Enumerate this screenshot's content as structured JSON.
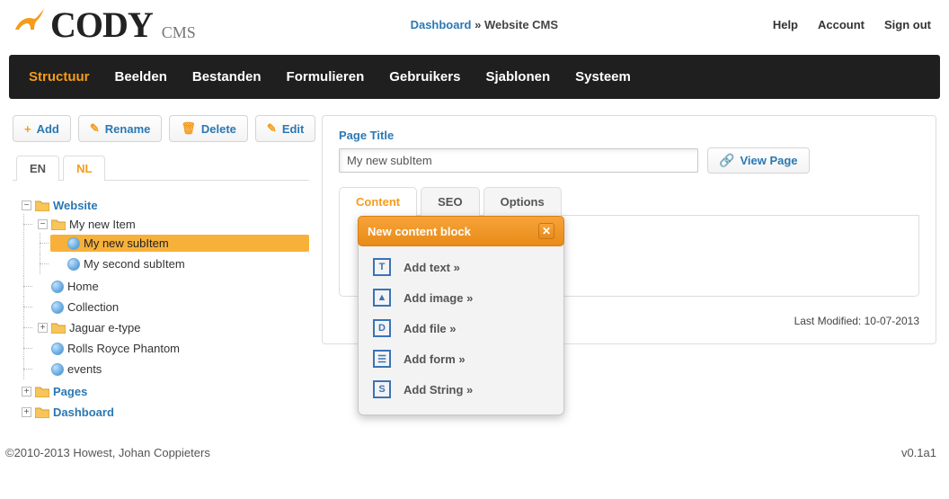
{
  "header": {
    "logo_text": "CODY",
    "logo_suffix": "CMS",
    "breadcrumb_link": "Dashboard",
    "breadcrumb_sep": " » ",
    "breadcrumb_current": "Website CMS",
    "links": {
      "help": "Help",
      "account": "Account",
      "signout": "Sign out"
    }
  },
  "nav": {
    "items": [
      "Structuur",
      "Beelden",
      "Bestanden",
      "Formulieren",
      "Gebruikers",
      "Sjablonen",
      "Systeem"
    ],
    "active_index": 0
  },
  "toolbar": {
    "add": "Add",
    "rename": "Rename",
    "delete": "Delete",
    "edit": "Edit"
  },
  "lang_tabs": {
    "items": [
      "EN",
      "NL"
    ],
    "active_index": 1
  },
  "tree": {
    "root": {
      "label": "Website",
      "children": [
        {
          "label": "My new Item",
          "children": [
            {
              "label": "My new subItem",
              "selected": true
            },
            {
              "label": "My second subItem"
            }
          ]
        },
        {
          "label": "Home"
        },
        {
          "label": "Collection"
        },
        {
          "label": "Jaguar e-type",
          "has_children": true
        },
        {
          "label": "Rolls Royce Phantom"
        },
        {
          "label": "events"
        }
      ]
    },
    "siblings": [
      "Pages",
      "Dashboard"
    ]
  },
  "panel": {
    "title_label": "Page Title",
    "title_value": "My new subItem",
    "view_page": "View Page",
    "tabs": [
      "Content",
      "SEO",
      "Options"
    ],
    "active_tab": 0,
    "last_modified_label": "Last Modified: ",
    "last_modified_value": "10-07-2013"
  },
  "popover": {
    "title": "New content block",
    "items": [
      {
        "glyph": "T",
        "label": "Add text »"
      },
      {
        "glyph": "▲",
        "label": "Add image »"
      },
      {
        "glyph": "D",
        "label": "Add file »"
      },
      {
        "glyph": "☰",
        "label": "Add form »"
      },
      {
        "glyph": "S",
        "label": "Add String »"
      }
    ]
  },
  "footer": {
    "copyright": "©2010-2013 Howest, Johan Coppieters",
    "version": "v0.1a1"
  }
}
